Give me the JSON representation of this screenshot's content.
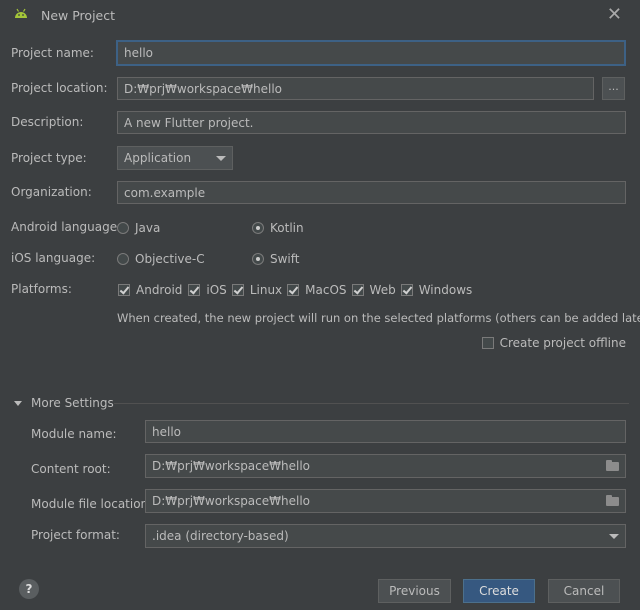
{
  "window": {
    "title": "New Project"
  },
  "form": {
    "project_name": {
      "label": "Project name:",
      "value": "hello"
    },
    "project_location": {
      "label": "Project location:",
      "value": "D:₩prj₩workspace₩hello",
      "browse_label": "..."
    },
    "description": {
      "label": "Description:",
      "value": "A new Flutter project."
    },
    "project_type": {
      "label": "Project type:",
      "value": "Application"
    },
    "organization": {
      "label": "Organization:",
      "value": "com.example"
    },
    "android_language": {
      "label": "Android language:",
      "options": [
        "Java",
        "Kotlin"
      ],
      "selected": "Kotlin"
    },
    "ios_language": {
      "label": "iOS language:",
      "options": [
        "Objective-C",
        "Swift"
      ],
      "selected": "Swift"
    },
    "platforms": {
      "label": "Platforms:",
      "items": [
        {
          "name": "Android",
          "checked": true
        },
        {
          "name": "iOS",
          "checked": true
        },
        {
          "name": "Linux",
          "checked": true
        },
        {
          "name": "MacOS",
          "checked": true
        },
        {
          "name": "Web",
          "checked": true
        },
        {
          "name": "Windows",
          "checked": true
        }
      ],
      "note": "When created, the new project will run on the selected platforms (others can be added later)."
    },
    "offline": {
      "label": "Create project offline",
      "checked": false
    }
  },
  "more_settings": {
    "title": "More Settings",
    "expanded": true,
    "module_name": {
      "label": "Module name:",
      "value": "hello"
    },
    "content_root": {
      "label": "Content root:",
      "value": "D:₩prj₩workspace₩hello"
    },
    "module_file_location": {
      "label": "Module file location:",
      "value": "D:₩prj₩workspace₩hello"
    },
    "project_format": {
      "label": "Project format:",
      "value": ".idea (directory-based)"
    }
  },
  "footer": {
    "help_label": "?",
    "previous_label": "Previous",
    "create_label": "Create",
    "cancel_label": "Cancel"
  },
  "colors": {
    "background": "#3c3f41",
    "field": "#45494a",
    "focus_border": "#3d6185",
    "primary_button": "#365880",
    "android_green": "#a4c639"
  }
}
